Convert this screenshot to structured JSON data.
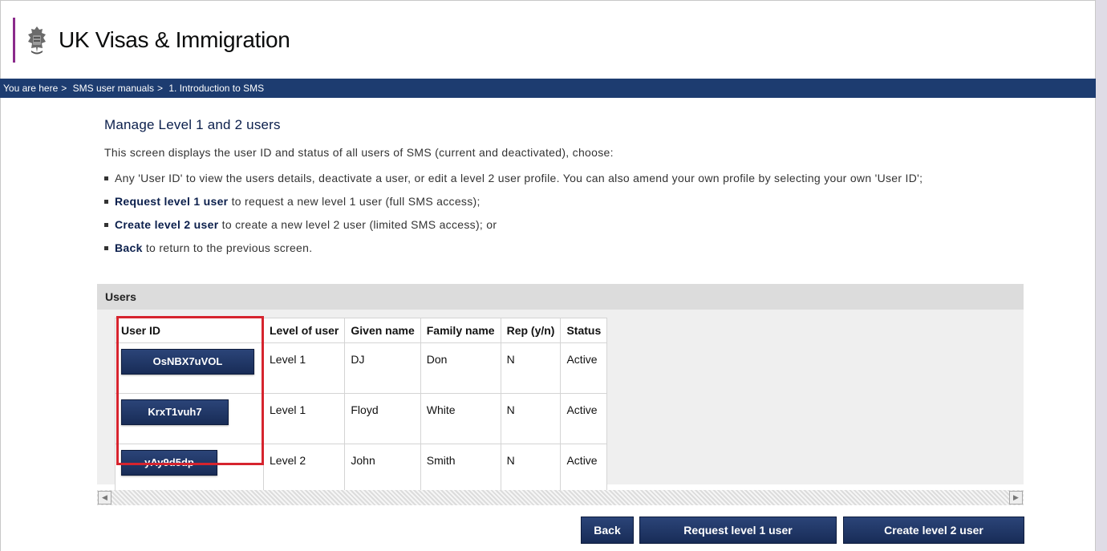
{
  "header": {
    "title": "UK Visas & Immigration",
    "brand_color": "#8b2a8b"
  },
  "breadcrumb": {
    "prefix": "You are here",
    "items": [
      "SMS user manuals",
      "1. Introduction to SMS"
    ],
    "separator": ">",
    "bg_color": "#1d3c70"
  },
  "page": {
    "title": "Manage Level 1 and 2 users",
    "intro": "This screen displays the user ID and status of all users of SMS (current and deactivated), choose:",
    "options": [
      {
        "bold": "",
        "text": "Any 'User ID' to view the users details, deactivate a user, or edit a level 2 user profile. You can also amend your own profile by selecting your own 'User ID';"
      },
      {
        "bold": "Request level 1 user",
        "text": " to request a new level 1 user (full SMS access);"
      },
      {
        "bold": "Create level 2 user",
        "text": " to create a new level 2 user (limited SMS access); or"
      },
      {
        "bold": "Back",
        "text": " to return to the previous screen."
      }
    ]
  },
  "users_panel": {
    "title": "Users",
    "columns": [
      "User ID",
      "Level of user",
      "Given name",
      "Family name",
      "Rep (y/n)",
      "Status"
    ],
    "rows": [
      {
        "user_id": "OsNBX7uVOL",
        "level": "Level 1",
        "given": "DJ",
        "family": "Don",
        "rep": "N",
        "status": "Active"
      },
      {
        "user_id": "KrxT1vuh7",
        "level": "Level 1",
        "given": "Floyd",
        "family": "White",
        "rep": "N",
        "status": "Active"
      },
      {
        "user_id": "yAy9d5dp",
        "level": "Level 2",
        "given": "John",
        "family": "Smith",
        "rep": "N",
        "status": "Active"
      }
    ],
    "highlight_color": "#d6242e"
  },
  "buttons": {
    "back": "Back",
    "request": "Request level 1 user",
    "create": "Create level 2 user"
  },
  "icons": {
    "crest": "royal-crest-icon",
    "scroll_left": "scroll-left-arrow-icon",
    "scroll_right": "scroll-right-arrow-icon"
  }
}
